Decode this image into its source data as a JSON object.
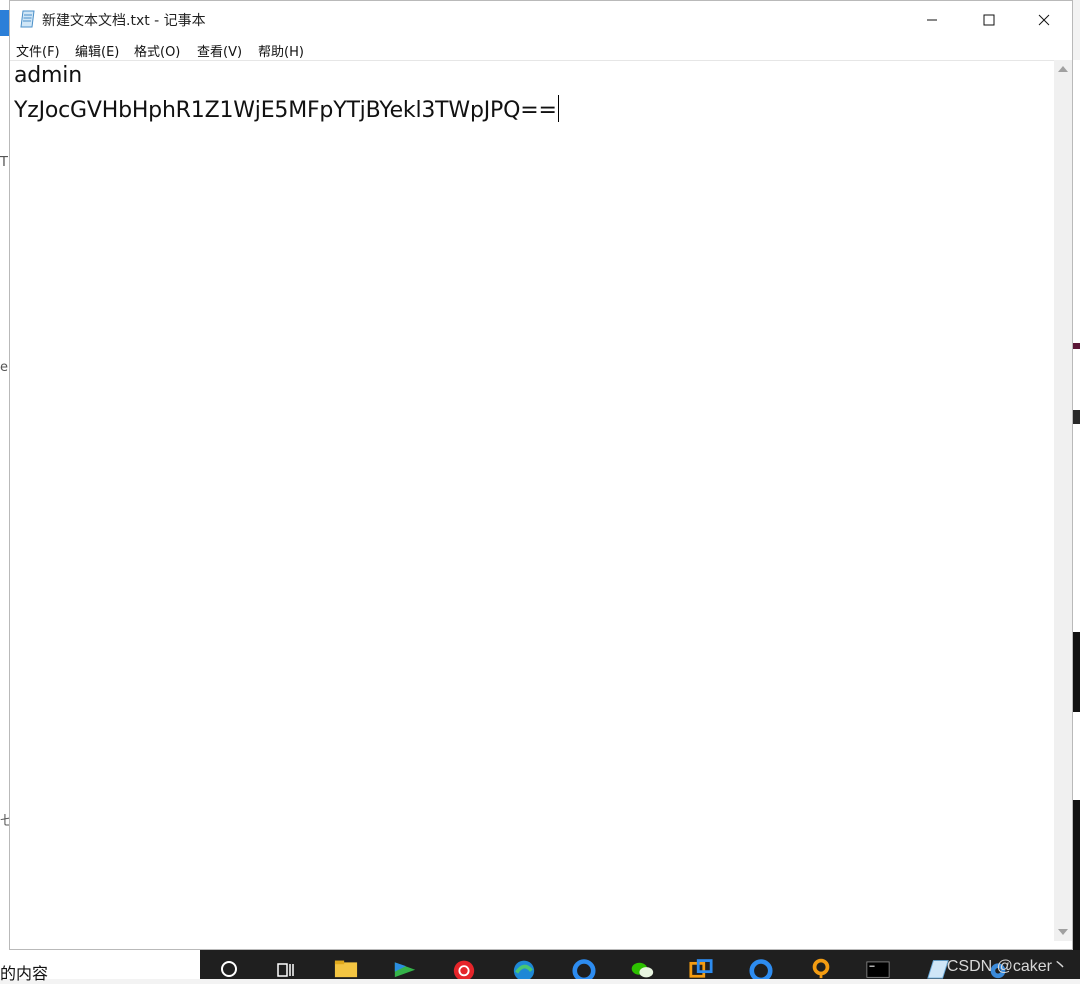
{
  "window": {
    "title": "新建文本文档.txt - 记事本"
  },
  "menu": [
    {
      "label": "文件(F)"
    },
    {
      "label": "编辑(E)"
    },
    {
      "label": "格式(O)"
    },
    {
      "label": "查看(V)"
    },
    {
      "label": "帮助(H)"
    }
  ],
  "editor": {
    "lines": [
      "admin",
      "YzJocGVHbHphR1Z1WjE5MFpYTjBYekl3TWpJPQ=="
    ]
  },
  "taskbar": {
    "left_text": "的内容",
    "icons": [
      "search-icon",
      "task-view-icon",
      "file-explorer-icon",
      "video-player-icon",
      "netease-music-icon",
      "edge-icon",
      "qq-browser-icon",
      "wechat-icon",
      "virtual-machine-icon",
      "qq-browser-icon-2",
      "app-icon",
      "terminal-icon",
      "notepad-icon",
      "settings-icon"
    ]
  },
  "watermark": "CSDN @caker丶",
  "colors": {
    "titlebar_bg": "#ffffff",
    "taskbar_bg": "#1f1f1f",
    "text": "#111111"
  }
}
